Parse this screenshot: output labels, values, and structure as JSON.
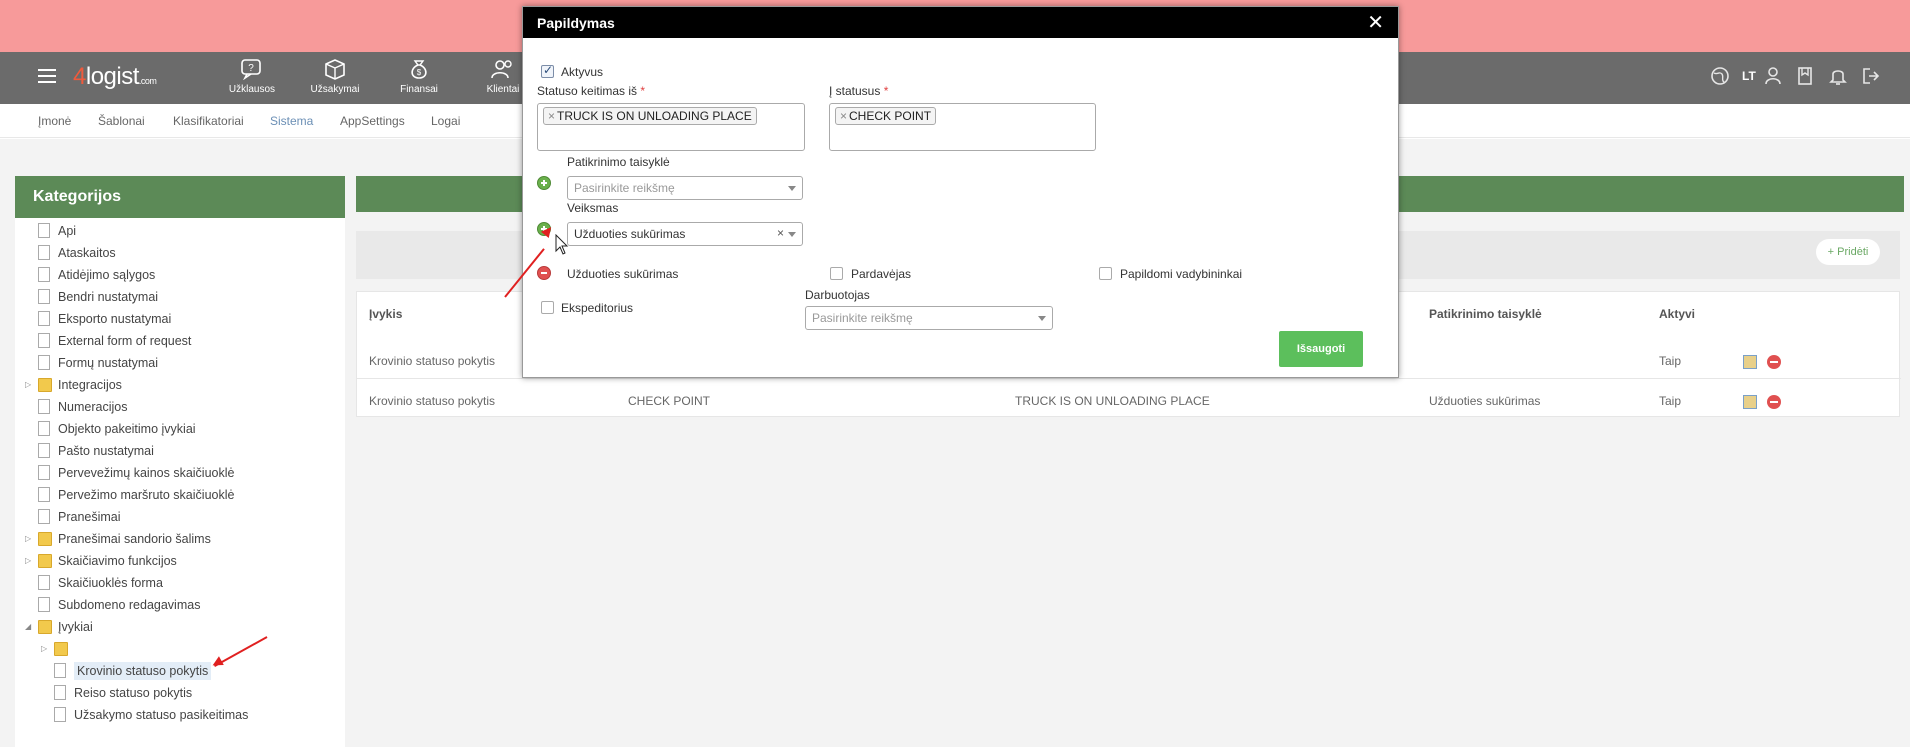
{
  "app": {
    "logo_text": "4logist",
    "logo_suffix": ".com",
    "language": "LT"
  },
  "navbar": {
    "items": [
      {
        "label": "Užklausos",
        "icon": "question-chat-icon"
      },
      {
        "label": "Užsakymai",
        "icon": "box-icon"
      },
      {
        "label": "Finansai",
        "icon": "money-bag-icon"
      },
      {
        "label": "Klientai",
        "icon": "users-icon"
      }
    ],
    "right_icons": [
      "globe-icon",
      "user-icon",
      "bookmark-icon",
      "bell-icon",
      "logout-icon"
    ]
  },
  "subnav": {
    "items": [
      "Įmonė",
      "Šablonai",
      "Klasifikatoriai",
      "Sistema",
      "AppSettings",
      "Logai"
    ],
    "active": "Sistema"
  },
  "sidebar": {
    "title": "Kategorijos",
    "items": [
      "Api",
      "Ataskaitos",
      "Atidėjimo sąlygos",
      "Bendri nustatymai",
      "Eksporto nustatymai",
      "External form of request",
      "Formų nustatymai",
      "Integracijos",
      "Numeracijos",
      "Objekto pakeitimo įvykiai",
      "Pašto nustatymai",
      "Pervevežimų kainos skaičiuoklė",
      "Pervežimo maršruto skaičiuoklė",
      "Pranešimai",
      "Pranešimai sandorio šalims",
      "Skaičiavimo funkcijos",
      "Skaičiuoklės forma",
      "Subdomeno redagavimas",
      "Įvykiai",
      "",
      "Krovinio statuso pokytis",
      "Reiso statuso pokytis",
      "Užsakymo statuso pasikeitimas"
    ]
  },
  "main": {
    "add_label": "Pridėti",
    "columns": [
      "Įvykis",
      "Patikrinimo taisyklė",
      "Aktyvi"
    ],
    "rows": [
      {
        "event": "Krovinio statuso pokytis",
        "to": "",
        "from": "",
        "rule": "",
        "active": "Taip"
      },
      {
        "event": "Krovinio statuso pokytis",
        "to": "CHECK POINT",
        "from": "TRUCK IS ON UNLOADING PLACE",
        "rule": "Užduoties sukūrimas",
        "active": "Taip"
      }
    ]
  },
  "modal": {
    "title": "Papildymas",
    "active_label": "Aktyvus",
    "from_label": "Statuso keitimas iš",
    "to_label": "Į statusus",
    "required_mark": "*",
    "from_tag": "TRUCK IS ON UNLOADING PLACE",
    "to_tag": "CHECK POINT",
    "rule_label": "Patikrinimo taisyklė",
    "rule_placeholder": "Pasirinkite reikšmę",
    "action_label": "Veiksmas",
    "action_value": "Užduoties sukūrimas",
    "task_label": "Užduoties sukūrimas",
    "seller_label": "Pardavėjas",
    "managers_label": "Papildomi vadybininkai",
    "forwarder_label": "Ekspeditorius",
    "employee_label": "Darbuotojas",
    "employee_placeholder": "Pasirinkite reikšmę",
    "save_label": "Išsaugoti",
    "close_glyph": "✕",
    "tag_remove_glyph": "×",
    "clear_glyph": "×"
  },
  "colors": {
    "banner": "#f79a9a",
    "navbar": "#6b6b6b",
    "accent_green": "#5c8a57",
    "save_green": "#5cbf5c",
    "annotation_red": "#e02020"
  }
}
